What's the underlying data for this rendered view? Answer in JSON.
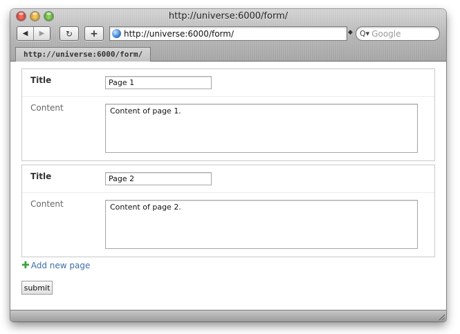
{
  "window": {
    "title": "http://universe:6000/form/"
  },
  "toolbar": {
    "back_icon": "back-arrow-icon",
    "back_glyph": "◀",
    "forward_icon": "forward-arrow-icon",
    "forward_glyph": "▶",
    "reload_icon": "reload-icon",
    "reload_glyph": "↻",
    "add_bookmark_icon": "plus-icon",
    "add_bookmark_glyph": "+",
    "url": "http://universe:6000/form/",
    "snapback_glyph": "◆",
    "search_icon": "magnifier-icon",
    "search_glyph": "Q▾",
    "search_placeholder": "Google"
  },
  "tabs": [
    {
      "label": "http://universe:6000/form/"
    }
  ],
  "form": {
    "pages": [
      {
        "title_label": "Title",
        "title_value": "Page 1",
        "content_label": "Content",
        "content_value": "Content of page 1."
      },
      {
        "title_label": "Title",
        "title_value": "Page 2",
        "content_label": "Content",
        "content_value": "Content of page 2."
      }
    ],
    "add_icon_glyph": "✚",
    "add_page_label": "Add new page",
    "submit_label": "submit"
  },
  "colors": {
    "link": "#3d6ea8",
    "add_icon": "#3ca13c"
  }
}
